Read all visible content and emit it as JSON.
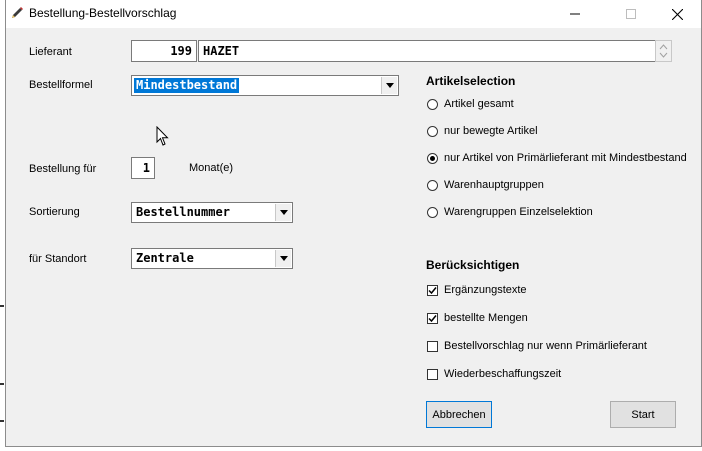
{
  "window": {
    "title": "Bestellung-Bestellvorschlag"
  },
  "labels": {
    "lieferant": "Lieferant",
    "bestellformel": "Bestellformel",
    "bestellung_fuer": "Bestellung für",
    "monat": "Monat(e)",
    "sortierung": "Sortierung",
    "standort": "für Standort"
  },
  "fields": {
    "lieferant_nr": "199",
    "lieferant_name": "HAZET",
    "bestellformel": "Mindestbestand",
    "bestellung_fuer": "1",
    "sortierung": "Bestellnummer",
    "standort": "Zentrale"
  },
  "artikelselection": {
    "title": "Artikelselection",
    "options": [
      {
        "label": "Artikel gesamt",
        "selected": false
      },
      {
        "label": "nur bewegte Artikel",
        "selected": false
      },
      {
        "label": "nur Artikel von Primärlieferant mit Mindestbestand",
        "selected": true
      },
      {
        "label": "Warenhauptgruppen",
        "selected": false
      },
      {
        "label": "Warengruppen Einzelselektion",
        "selected": false
      }
    ]
  },
  "beruecksichtigen": {
    "title": "Berücksichtigen",
    "options": [
      {
        "label": "Ergänzungstexte",
        "checked": true
      },
      {
        "label": "bestellte Mengen",
        "checked": true
      },
      {
        "label": "Bestellvorschlag nur wenn Primärlieferant",
        "checked": false
      },
      {
        "label": "Wiederbeschaffungszeit",
        "checked": false
      }
    ]
  },
  "buttons": {
    "cancel": "Abbrechen",
    "start": "Start"
  },
  "icons": {
    "app": "pencil-icon",
    "minimize": "minimize-icon",
    "maximize": "maximize-icon",
    "close": "close-icon",
    "cursor": "mouse-cursor-icon"
  }
}
